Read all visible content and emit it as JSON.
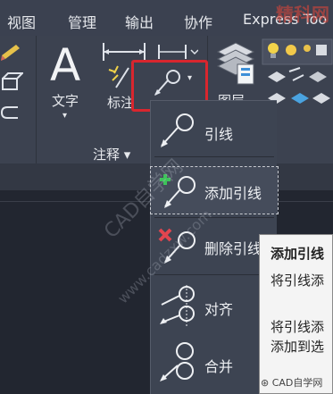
{
  "menu": [
    "视图",
    "管理",
    "输出",
    "协作",
    "Express Too"
  ],
  "brand_watermark": "精科网",
  "ribbon": {
    "text_tool_label": "文字",
    "text_tool_letter": "A",
    "dimension_label": "标注",
    "layer_label": "图层",
    "panel_label": "注释 ▾"
  },
  "leader_dropdown": {
    "items": [
      {
        "label": "引线"
      },
      {
        "label": "添加引线"
      },
      {
        "label": "删除引线"
      },
      {
        "label": "对齐"
      },
      {
        "label": "合并"
      }
    ]
  },
  "tooltip": {
    "title": "添加引线",
    "line1": "将引线添",
    "line2": "将引线添",
    "line3": "添加到选"
  },
  "watermark": "CAD自学网",
  "watermark2": "www.cadzxw.com",
  "footer_watermark": "CAD自学网",
  "colors": {
    "highlight_box": "#d9262e",
    "add_plus": "#3ec35a",
    "remove_x": "#e2454f"
  }
}
